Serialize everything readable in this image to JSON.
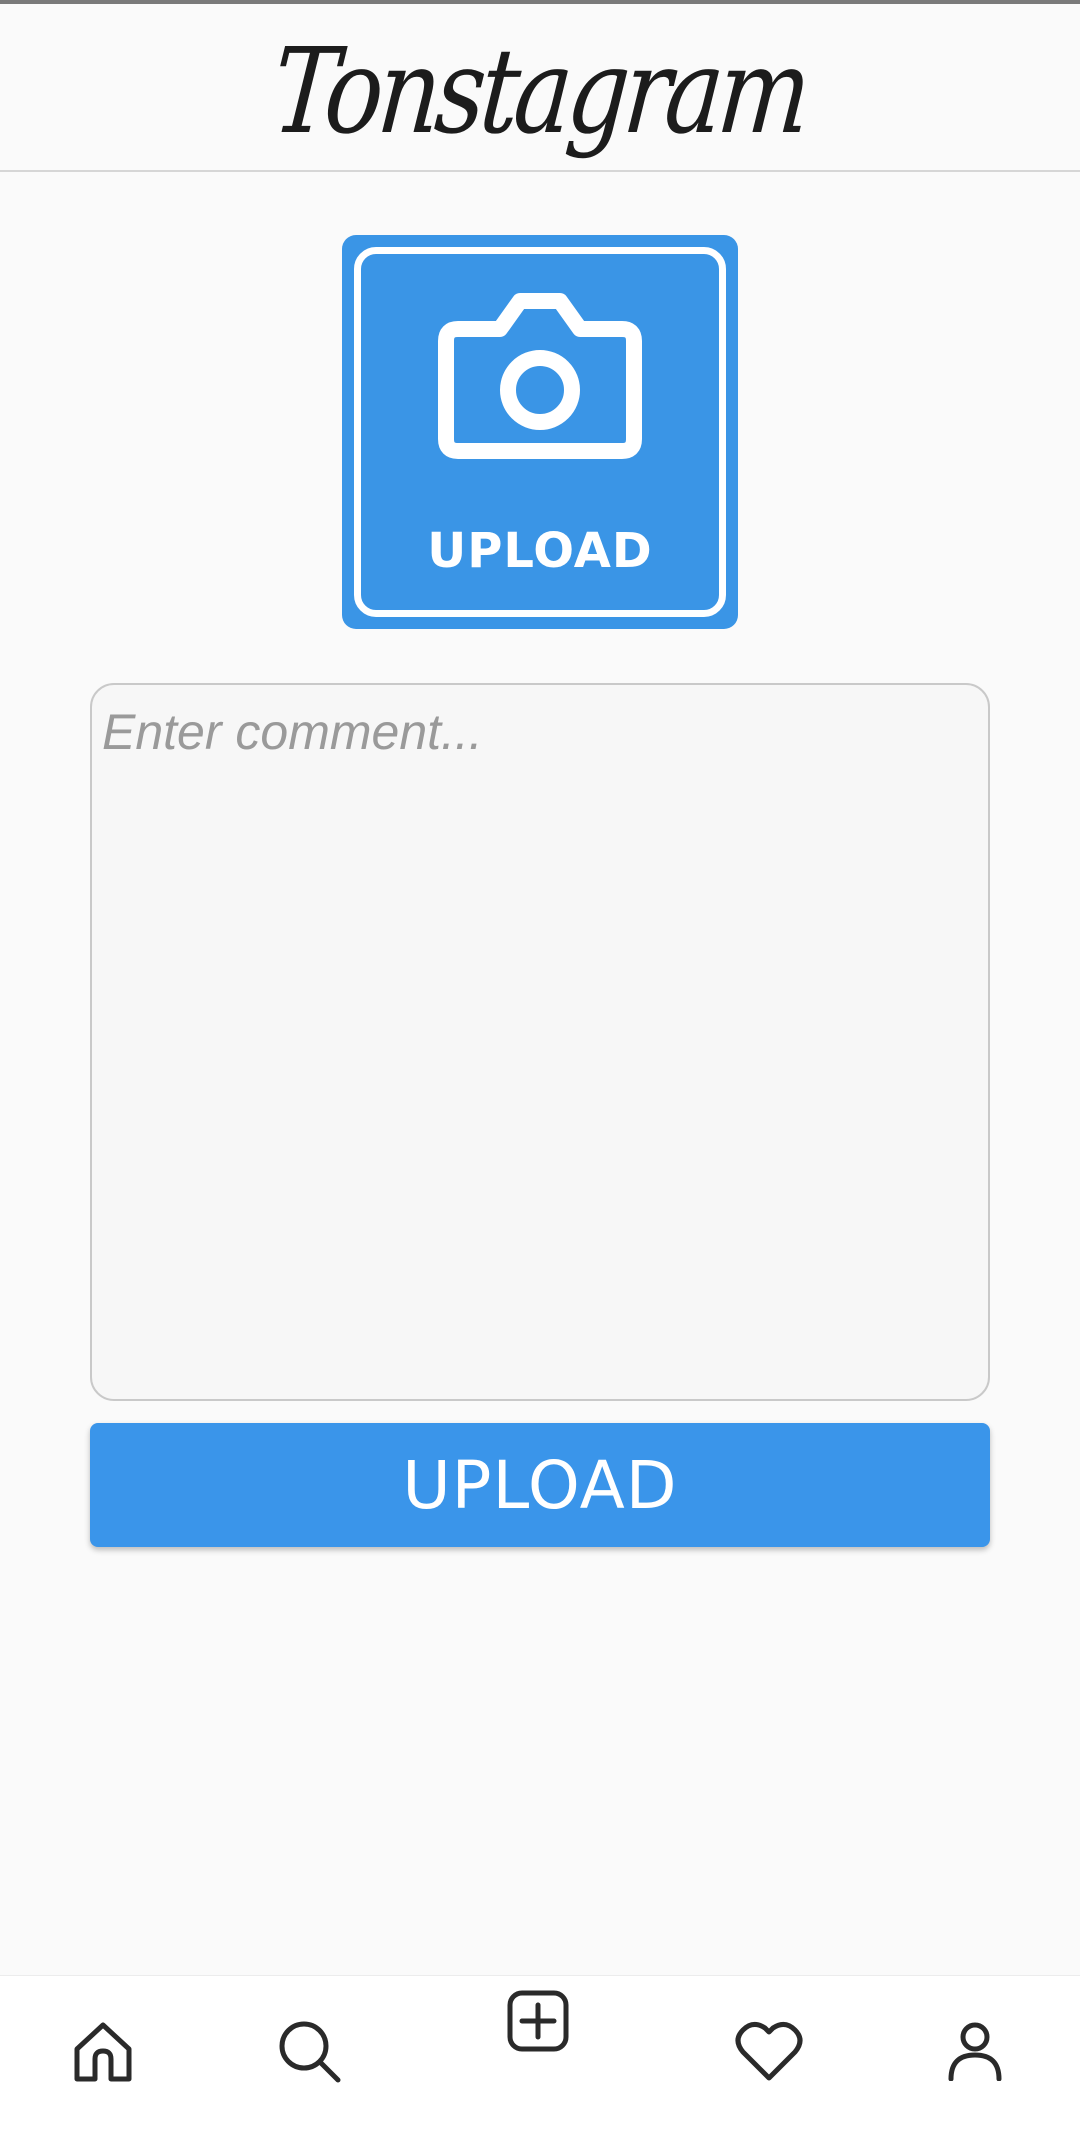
{
  "app": {
    "title": "Tonstagram"
  },
  "photo_picker": {
    "label": "UPLOAD",
    "icon": "camera-icon",
    "background_color": "#3a95e6"
  },
  "comment": {
    "placeholder": "Enter comment...",
    "value": ""
  },
  "upload_button": {
    "label": "UPLOAD",
    "background_color": "#3a95ea"
  },
  "bottom_nav": {
    "items": [
      {
        "id": "home",
        "icon": "home-icon"
      },
      {
        "id": "search",
        "icon": "search-icon"
      },
      {
        "id": "add",
        "icon": "add-post-icon"
      },
      {
        "id": "likes",
        "icon": "heart-icon"
      },
      {
        "id": "profile",
        "icon": "profile-icon"
      }
    ]
  }
}
